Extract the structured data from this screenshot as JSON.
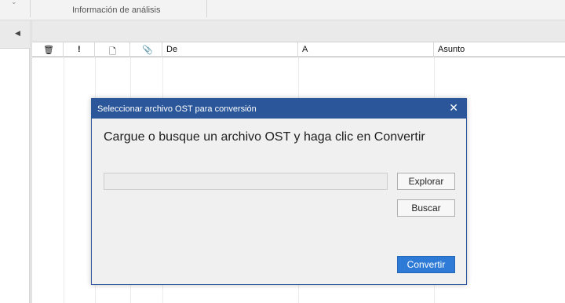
{
  "ribbon": {
    "group_label": "Información de análisis"
  },
  "grid": {
    "columns": [
      {
        "id": "delete",
        "icon": "trash-icon",
        "glyph": "🗑"
      },
      {
        "id": "importance",
        "icon": "exclamation-icon",
        "glyph": "!"
      },
      {
        "id": "item-type",
        "icon": "document-icon",
        "glyph": "🗋"
      },
      {
        "id": "attachment",
        "icon": "paperclip-icon",
        "glyph": "📎"
      },
      {
        "id": "from",
        "label": "De"
      },
      {
        "id": "to",
        "label": "A"
      },
      {
        "id": "subject",
        "label": "Asunto"
      }
    ]
  },
  "dialog": {
    "title": "Seleccionar archivo OST para conversión",
    "close_glyph": "✕",
    "instruction": "Cargue o busque un archivo OST y haga clic en Convertir",
    "path_value": "",
    "browse_label": "Explorar",
    "search_label": "Buscar",
    "convert_label": "Convertir"
  },
  "colors": {
    "dialog_title_bar": "#2b579a",
    "primary_button": "#2d7bd6"
  }
}
